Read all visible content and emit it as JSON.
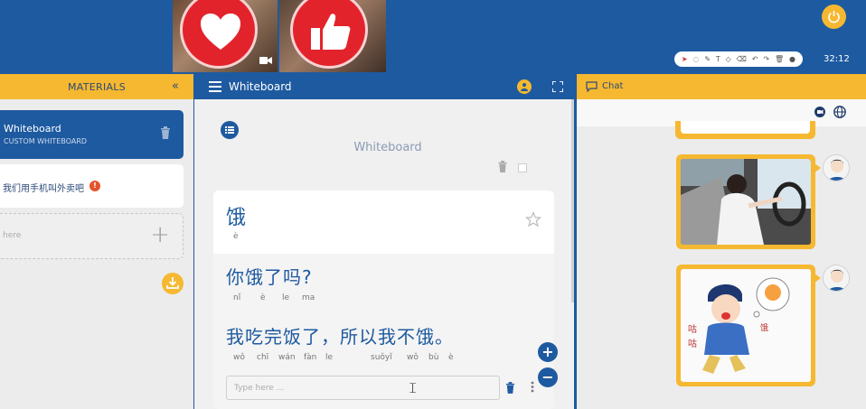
{
  "header": {
    "timer": "32:12",
    "toolbar_icons": [
      "pointer-icon",
      "lasso-icon",
      "pencil-icon",
      "text-icon",
      "shape-icon",
      "eraser-icon",
      "undo-icon",
      "redo-icon",
      "trash-icon",
      "eye-icon"
    ],
    "reactions": [
      "heart-icon",
      "thumbs-up-icon"
    ],
    "colors": {
      "brand_blue": "#1e5aa0",
      "accent_yellow": "#f5b830",
      "reaction_red": "#e3232c"
    }
  },
  "materials": {
    "title": "MATERIALS",
    "collapse_label": "«",
    "items": [
      {
        "name": "Whiteboard",
        "subtitle": "CUSTOM WHITEBOARD"
      },
      {
        "name": "我们用手机叫外卖吧",
        "badge": "!"
      }
    ],
    "add_placeholder": "here",
    "add_symbol": "+"
  },
  "whiteboard": {
    "header_title": "Whiteboard",
    "title": "Whiteboard",
    "card": {
      "word": "饿",
      "word_pinyin": "è",
      "sentence1": "你饿了吗?",
      "sentence1_pinyin": [
        "nǐ",
        "è",
        "le",
        "ma"
      ],
      "sentence2": "我吃完饭了，所以我不饿。",
      "sentence2_pinyin": [
        "wǒ",
        "chī",
        "wán",
        "fàn",
        "le",
        "",
        "suǒyǐ",
        "wǒ",
        "bù",
        "è"
      ]
    },
    "input_placeholder": "Type here ...",
    "add_label": "+",
    "remove_label": "−"
  },
  "chat": {
    "title": "Chat",
    "messages": [
      {
        "type": "image",
        "content": "woman-driving-car-photo"
      },
      {
        "type": "image",
        "content": "hungry-cartoon-sticker"
      }
    ]
  }
}
